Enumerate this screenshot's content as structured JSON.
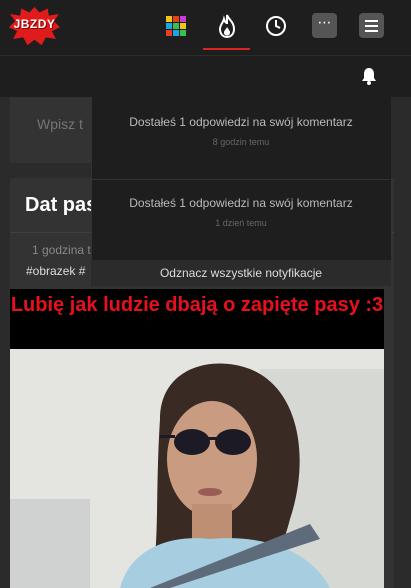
{
  "brand": {
    "logo_text": "JBZDY",
    "accent": "#e01b1b"
  },
  "nav": {
    "icons": [
      "grid-icon",
      "fire-icon",
      "clock-icon",
      "more-icon",
      "menu-icon"
    ],
    "more_label": "⋯",
    "active": "fire-icon"
  },
  "subbar": {
    "icon": "bell-icon"
  },
  "search": {
    "placeholder": "Wpisz t"
  },
  "post": {
    "title": "Dat pas",
    "meta": "1 godzina t",
    "tags": "#obrazek #",
    "caption": "Lubię jak ludzie dbają o zapięte pasy :3"
  },
  "notifications": {
    "items": [
      {
        "text": "Dostałeś 1 odpowiedzi na swój komentarz",
        "time": "8 godzin temu"
      },
      {
        "text": "Dostałeś 1 odpowiedzi na swój komentarz",
        "time": "1 dzień temu"
      }
    ],
    "mark_all": "Odznacz wszystkie notyfikacje"
  }
}
